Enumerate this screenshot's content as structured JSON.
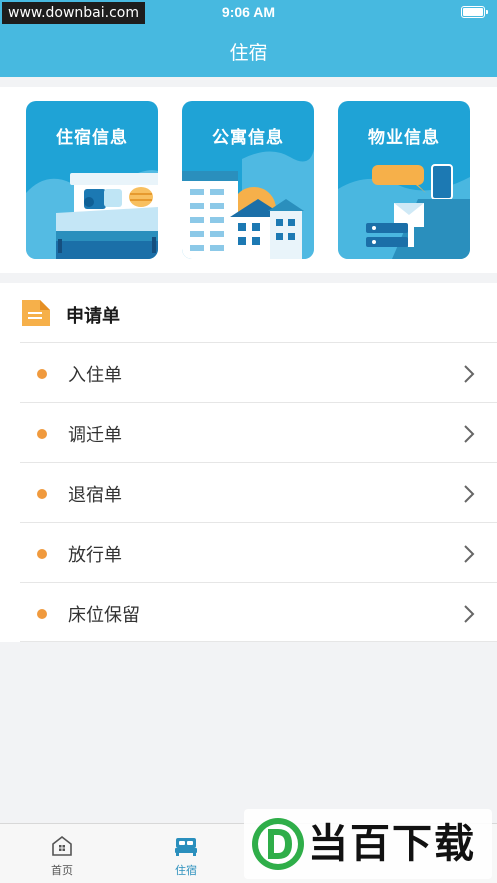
{
  "status_bar": {
    "watermark": "www.downbai.com",
    "time": "9:06 AM"
  },
  "nav": {
    "title": "住宿"
  },
  "cards": [
    {
      "title": "住宿信息"
    },
    {
      "title": "公寓信息"
    },
    {
      "title": "物业信息"
    }
  ],
  "applications": {
    "title": "申请单",
    "items": [
      {
        "label": "入住单"
      },
      {
        "label": "调迁单"
      },
      {
        "label": "退宿单"
      },
      {
        "label": "放行单"
      },
      {
        "label": "床位保留"
      }
    ]
  },
  "tabbar": {
    "tabs": [
      {
        "label": "首页",
        "icon": "home-icon"
      },
      {
        "label": "住宿",
        "icon": "bed-icon",
        "active": true
      }
    ]
  },
  "brand": {
    "logo": "D",
    "text": "当百下载"
  },
  "colors": {
    "header": "#47b9e0",
    "accent_dot": "#f09a3e",
    "active_tab": "#2a8fbd"
  }
}
